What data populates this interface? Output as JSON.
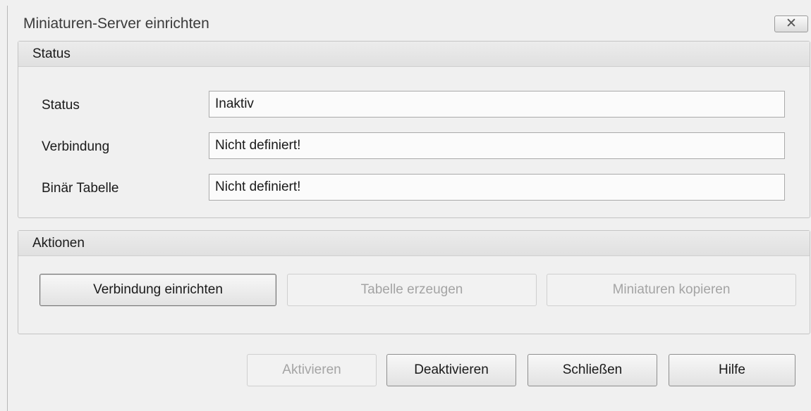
{
  "window": {
    "title": "Miniaturen-Server einrichten",
    "close_icon": "close-icon",
    "close_glyph": "✕"
  },
  "status_group": {
    "header": "Status",
    "rows": [
      {
        "label": "Status",
        "value": "Inaktiv"
      },
      {
        "label": "Verbindung",
        "value": "Nicht definiert!"
      },
      {
        "label": "Binär Tabelle",
        "value": "Nicht definiert!"
      }
    ]
  },
  "actions_group": {
    "header": "Aktionen",
    "buttons": [
      {
        "label": "Verbindung einrichten",
        "enabled": true
      },
      {
        "label": "Tabelle erzeugen",
        "enabled": false
      },
      {
        "label": "Miniaturen kopieren",
        "enabled": false
      }
    ]
  },
  "footer": {
    "buttons": [
      {
        "label": "Aktivieren",
        "enabled": false
      },
      {
        "label": "Deaktivieren",
        "enabled": true
      },
      {
        "label": "Schließen",
        "enabled": true
      },
      {
        "label": "Hilfe",
        "enabled": true
      }
    ]
  }
}
